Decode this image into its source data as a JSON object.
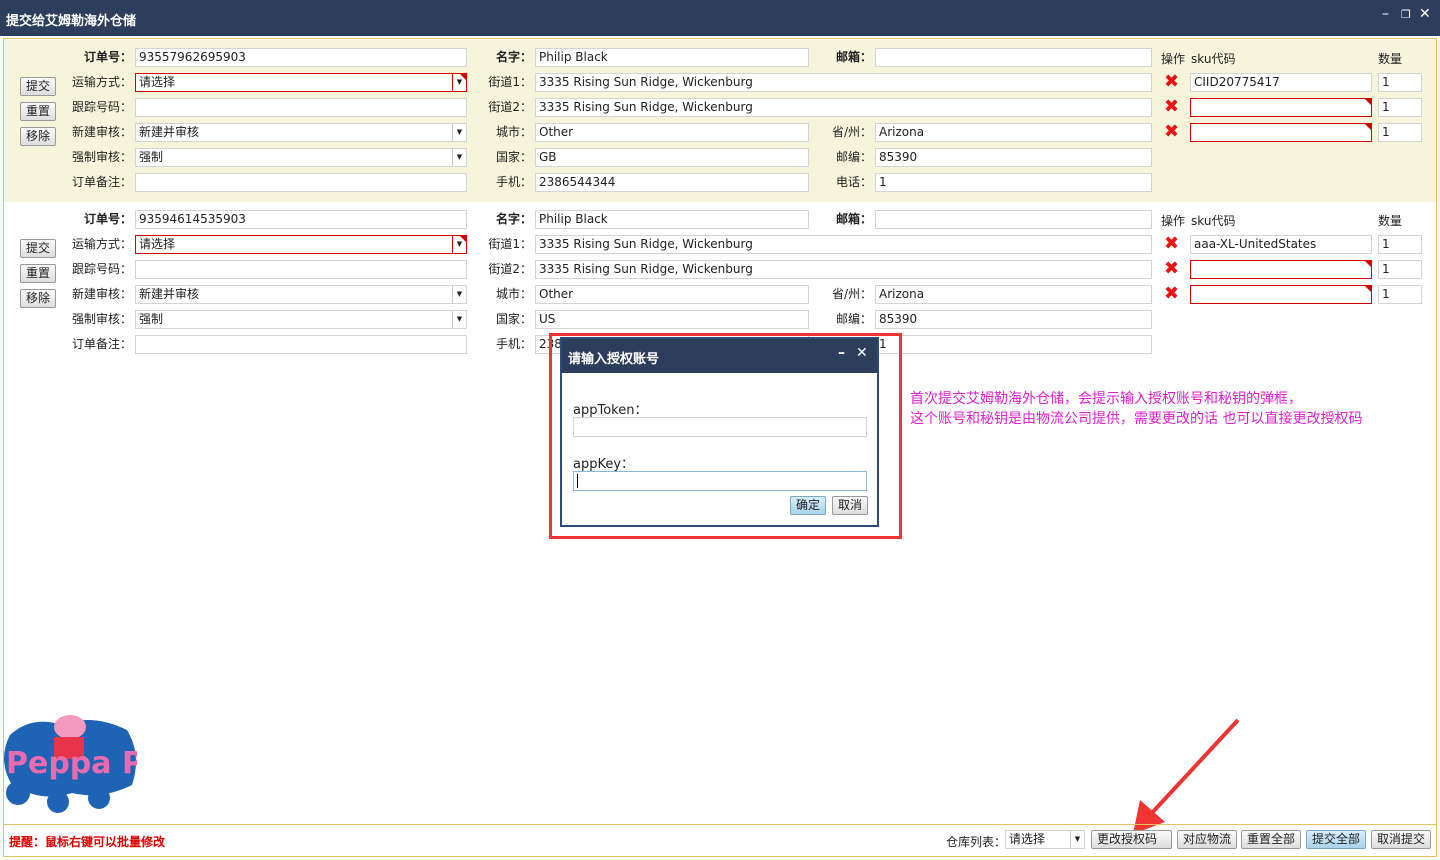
{
  "window": {
    "title": "提交给艾姆勒海外仓储",
    "controls": [
      "minimize",
      "restore",
      "close"
    ]
  },
  "labels": {
    "order_no": "订单号：",
    "shipping": "运输方式：",
    "tracking": "跟踪号码：",
    "new_review": "新建审核：",
    "force_review": "强制审核：",
    "remark": "订单备注：",
    "name": "名字：",
    "street1": "街道1：",
    "street2": "街道2：",
    "city": "城市：",
    "country": "国家：",
    "mobile": "手机：",
    "email": "邮箱：",
    "state": "省/州：",
    "zip": "邮编：",
    "phone": "电话：",
    "op": "操作",
    "sku": "sku代码",
    "qty": "数量"
  },
  "row_buttons": {
    "submit": "提交",
    "reset": "重置",
    "remove": "移除"
  },
  "orders": [
    {
      "order_no": "93557962695903",
      "shipping": "请选择",
      "tracking": "",
      "new_review": "新建并审核",
      "force_review": "强制",
      "remark": "",
      "name": "Philip Black",
      "street1": "3335 Rising Sun Ridge, Wickenburg",
      "street2": "3335 Rising Sun Ridge, Wickenburg",
      "city": "Other",
      "country": "GB",
      "mobile": "2386544344",
      "email": "",
      "state": "Arizona",
      "zip": "85390",
      "phone": "1",
      "items": [
        {
          "sku": "CIID20775417",
          "qty": "1"
        },
        {
          "sku": "",
          "qty": "1"
        },
        {
          "sku": "",
          "qty": "1"
        }
      ]
    },
    {
      "order_no": "93594614535903",
      "shipping": "请选择",
      "tracking": "",
      "new_review": "新建并审核",
      "force_review": "强制",
      "remark": "",
      "name": "Philip Black",
      "street1": "3335 Rising Sun Ridge, Wickenburg",
      "street2": "3335 Rising Sun Ridge, Wickenburg",
      "city": "Other",
      "country": "US",
      "mobile": "2386544344",
      "email": "",
      "state": "Arizona",
      "zip": "85390",
      "phone": "1",
      "items": [
        {
          "sku": "aaa-XL-UnitedStates",
          "qty": "1"
        },
        {
          "sku": "",
          "qty": "1"
        },
        {
          "sku": "",
          "qty": "1"
        }
      ]
    }
  ],
  "dialog": {
    "title": "请输入授权账号",
    "token_label": "appToken：",
    "token_value": "",
    "key_label": "appKey：",
    "key_value": "",
    "ok": "确定",
    "cancel": "取消"
  },
  "annotation": {
    "line1": "首次提交艾姆勒海外仓储，会提示输入授权账号和秘钥的弹框，",
    "line2": "这个账号和秘钥是由物流公司提供，需要更改的话 也可以直接更改授权码"
  },
  "logo": {
    "text": "Peppa Pig"
  },
  "footer": {
    "hint": "提醒：鼠标右键可以批量修改",
    "warehouse_label": "仓库列表：",
    "warehouse_value": "请选择",
    "change_auth": "更改授权码",
    "map_logistics": "对应物流",
    "reset_all": "重置全部",
    "submit_all": "提交全部",
    "cancel_submit": "取消提交"
  },
  "colors": {
    "titlebar": "#2d3e5c",
    "order_bg": "#f6f5dc",
    "error": "#d40000",
    "annotation": "#e020d0",
    "hint": "#e00000"
  }
}
